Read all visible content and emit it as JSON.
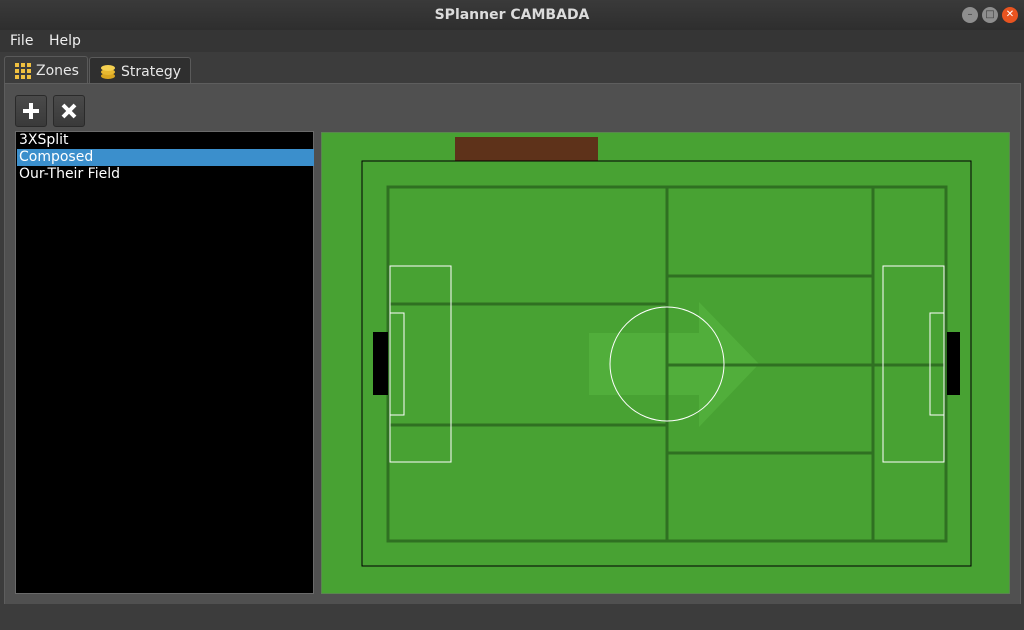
{
  "window": {
    "title": "SPlanner CAMBADA"
  },
  "menu": {
    "items": [
      "File",
      "Help"
    ]
  },
  "tabs": [
    {
      "label": "Zones",
      "icon": "grid-icon",
      "active": true
    },
    {
      "label": "Strategy",
      "icon": "coins-icon",
      "active": false
    }
  ],
  "toolbar": {
    "add_icon": "plus-icon",
    "remove_icon": "x-icon"
  },
  "zones": {
    "items": [
      "3XSplit",
      "Composed",
      "Our-Their Field"
    ],
    "selected": "Composed"
  },
  "field": {
    "colors": {
      "grass": "#48a233",
      "zone_line": "#2f7022",
      "goal": "#000000",
      "bench": "#5e321a",
      "arrow": "#56b33f",
      "selection": "#3b8fcc"
    }
  }
}
